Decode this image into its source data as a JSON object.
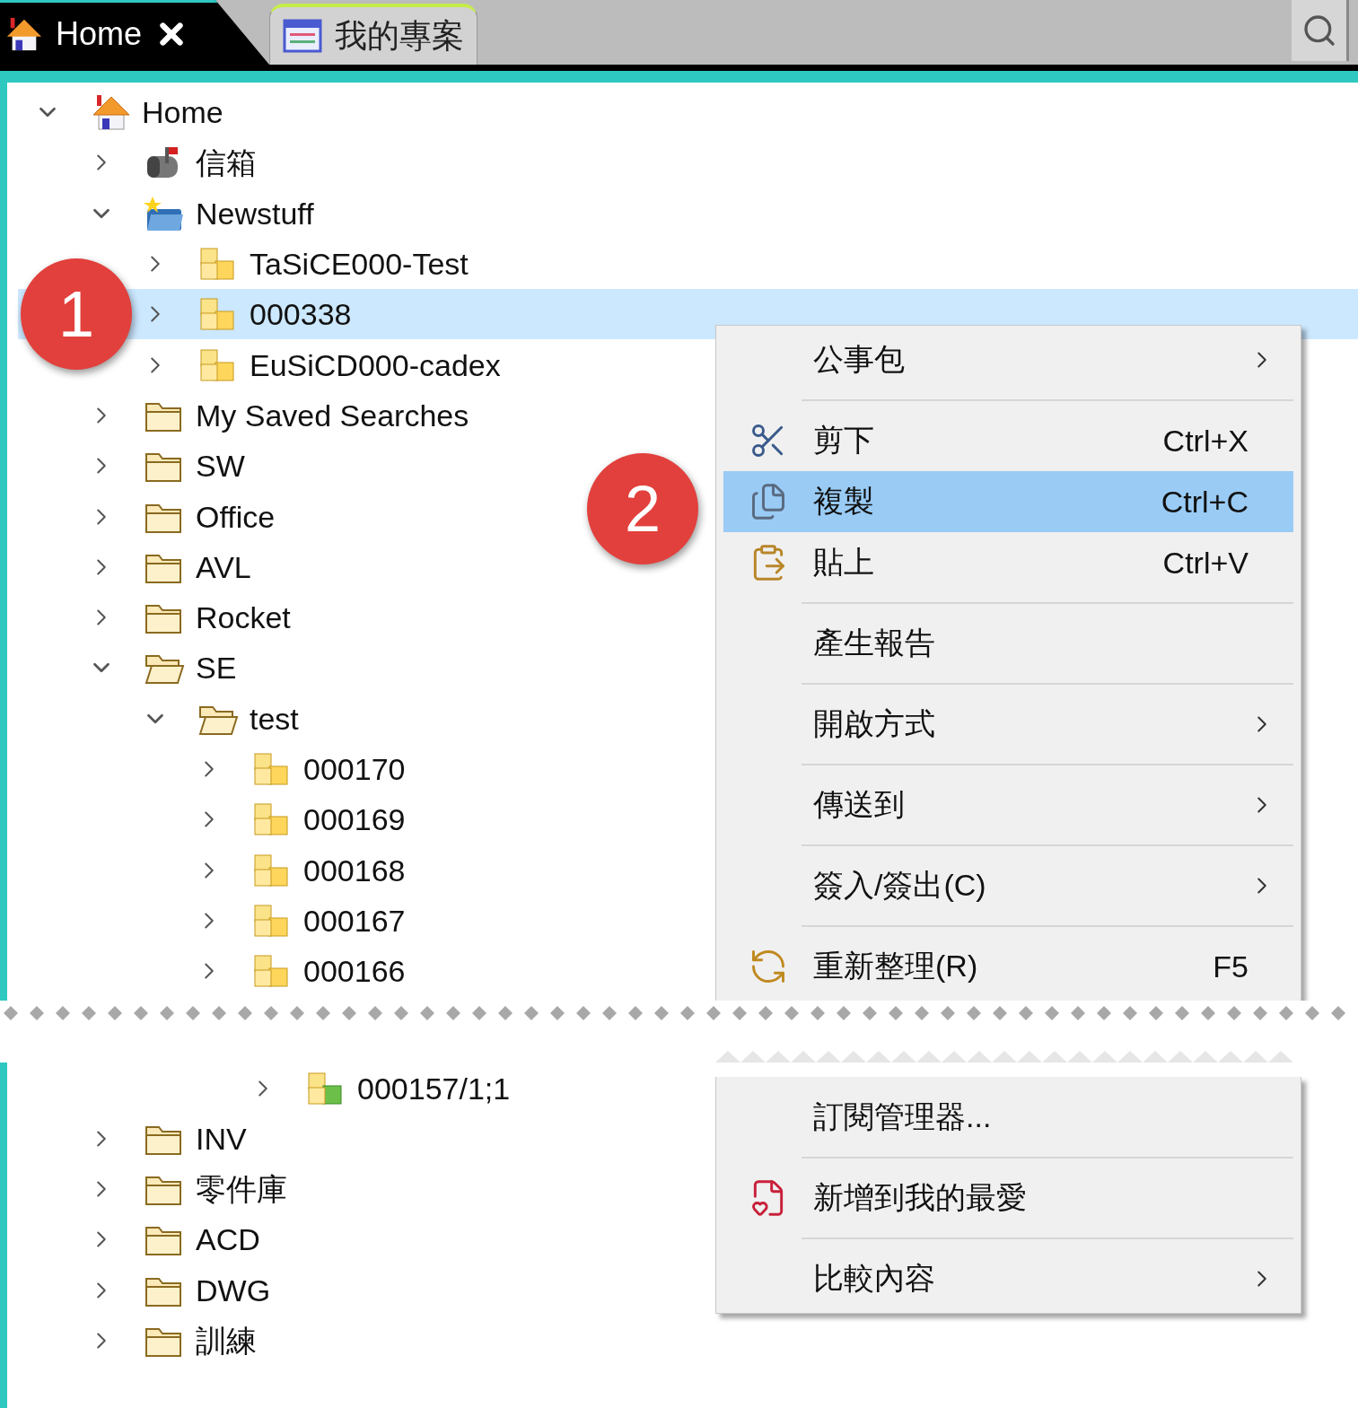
{
  "tabs": [
    {
      "label": "Home",
      "kind": "home",
      "selected": true
    },
    {
      "label": "我的專案",
      "kind": "project",
      "selected": false
    }
  ],
  "tree": [
    {
      "label": "Home",
      "kind": "home",
      "expanded": true,
      "selected": false,
      "children": [
        {
          "label": "信箱",
          "kind": "mailbox",
          "expanded": false,
          "selected": false
        },
        {
          "label": "Newstuff",
          "kind": "inbox",
          "expanded": true,
          "selected": false,
          "children": [
            {
              "label": "TaSiCE000-Test",
              "kind": "package",
              "expanded": false,
              "selected": false
            },
            {
              "label": "000338",
              "kind": "package",
              "expanded": false,
              "selected": true
            },
            {
              "label": "EuSiCD000-cadex",
              "kind": "package",
              "expanded": false,
              "selected": false
            }
          ]
        },
        {
          "label": "My Saved Searches",
          "kind": "folder",
          "expanded": false,
          "selected": false
        },
        {
          "label": "SW",
          "kind": "folder",
          "expanded": false,
          "selected": false
        },
        {
          "label": "Office",
          "kind": "folder",
          "expanded": false,
          "selected": false
        },
        {
          "label": "AVL",
          "kind": "folder",
          "expanded": false,
          "selected": false
        },
        {
          "label": "Rocket",
          "kind": "folder",
          "expanded": false,
          "selected": false
        },
        {
          "label": "SE",
          "kind": "folder",
          "expanded": true,
          "selected": false,
          "children": [
            {
              "label": "test",
              "kind": "folder",
              "expanded": true,
              "selected": false,
              "children": [
                {
                  "label": "000170",
                  "kind": "package",
                  "expanded": false,
                  "selected": false
                },
                {
                  "label": "000169",
                  "kind": "package",
                  "expanded": false,
                  "selected": false
                },
                {
                  "label": "000168",
                  "kind": "package",
                  "expanded": false,
                  "selected": false
                },
                {
                  "label": "000167",
                  "kind": "package",
                  "expanded": false,
                  "selected": false
                },
                {
                  "label": "000166",
                  "kind": "package",
                  "expanded": false,
                  "selected": false
                },
                {
                  "kind": "tear",
                  "children": [
                    {
                      "label": "000157/1;1",
                      "kind": "package-green",
                      "expanded": false,
                      "selected": false
                    }
                  ]
                }
              ]
            }
          ]
        },
        {
          "label": "INV",
          "kind": "folder",
          "expanded": false,
          "selected": false
        },
        {
          "label": "零件庫",
          "kind": "folder",
          "expanded": false,
          "selected": false
        },
        {
          "label": "ACD",
          "kind": "folder",
          "expanded": false,
          "selected": false
        },
        {
          "label": "DWG",
          "kind": "folder",
          "expanded": false,
          "selected": false
        },
        {
          "label": "訓練",
          "kind": "folder",
          "expanded": false,
          "selected": false
        }
      ]
    }
  ],
  "context_menu": [
    {
      "kind": "item",
      "label": "公事包",
      "submenu": true,
      "selected": false
    },
    {
      "kind": "separator"
    },
    {
      "kind": "item",
      "label": "剪下",
      "shortcut": "Ctrl+X",
      "submenu": false,
      "selected": false
    },
    {
      "kind": "item",
      "label": "複製",
      "shortcut": "Ctrl+C",
      "submenu": false,
      "selected": true
    },
    {
      "kind": "item",
      "label": "貼上",
      "shortcut": "Ctrl+V",
      "submenu": false,
      "selected": false
    },
    {
      "kind": "separator"
    },
    {
      "kind": "item",
      "label": "產生報告",
      "submenu": false,
      "selected": false
    },
    {
      "kind": "separator"
    },
    {
      "kind": "item",
      "label": "開啟方式",
      "submenu": true,
      "selected": false
    },
    {
      "kind": "separator"
    },
    {
      "kind": "item",
      "label": "傳送到",
      "submenu": true,
      "selected": false
    },
    {
      "kind": "separator"
    },
    {
      "kind": "item",
      "label": "簽入/簽出(C)",
      "submenu": true,
      "selected": false
    },
    {
      "kind": "separator"
    },
    {
      "kind": "item",
      "label": "重新整理(R)",
      "shortcut": "F5",
      "submenu": false,
      "selected": false
    },
    {
      "kind": "tear"
    },
    {
      "kind": "item",
      "label": "訂閱管理器...",
      "submenu": false,
      "selected": false
    },
    {
      "kind": "separator"
    },
    {
      "kind": "item",
      "label": "新增到我的最愛",
      "submenu": false,
      "selected": false
    },
    {
      "kind": "separator"
    },
    {
      "kind": "item",
      "label": "比較內容",
      "submenu": true,
      "selected": false
    }
  ],
  "callouts": [
    {
      "label": "1"
    },
    {
      "label": "2"
    }
  ]
}
